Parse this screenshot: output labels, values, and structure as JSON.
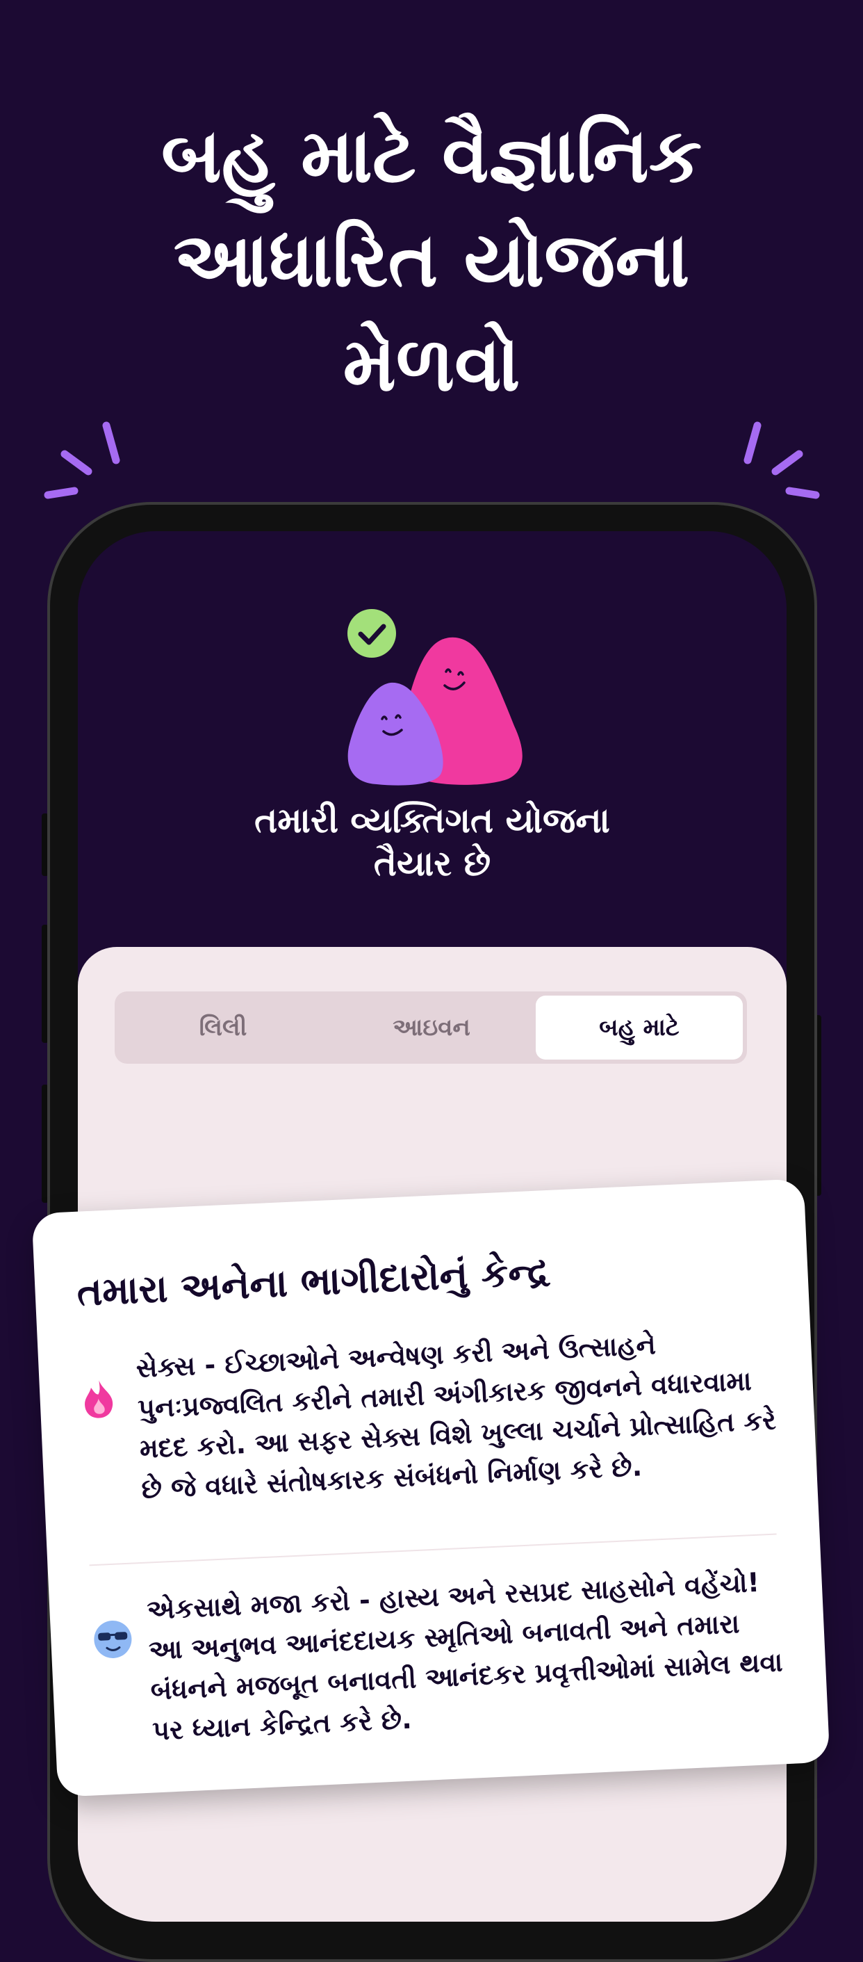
{
  "headline": {
    "line1": "બહુ માટે વૈજ્ઞાનિક",
    "line2": "આધારિત યોજના",
    "line3": "મેળવો"
  },
  "colors": {
    "background": "#1c0a33",
    "accent_purple": "#a66bf2",
    "mascot_pink": "#f0399f",
    "check_green": "#a3e07a",
    "sheet": "#f3e8ec"
  },
  "phone": {
    "ready_title_line1": "તમારી વ્યક્તિગત યોજના",
    "ready_title_line2": "તૈયાર છે",
    "tabs": [
      {
        "label": "લિલી",
        "active": false
      },
      {
        "label": "આઇવન",
        "active": false
      },
      {
        "label": "બહુ માટે",
        "active": true
      }
    ]
  },
  "card": {
    "title": "તમારા અનેના ભાગીદારોનું કેન્દ્ર",
    "items": [
      {
        "icon": "flame-icon",
        "text": "સેક્સ - ઈચ્છાઓને અન્વેષણ કરી અને ઉત્સાહને પુનઃપ્રજ્વલિત કરીને તમારી અંગીકારક જીવનને વધારવામા મદદ કરો. આ સફર સેક્સ વિશે ખુલ્લા ચર્ચાને પ્રોત્સાહિત કરે છે જે વધારે સંતોષકારક સંબંધનો નિર્માણ કરે છે."
      },
      {
        "icon": "sunglasses-face-icon",
        "text": "એકસાથે મજા કરો - હાસ્ય અને રસપ્રદ સાહસોને વહેંચો! આ અનુભવ આનંદદાયક સ્મૃતિઓ બનાવતી અને તમારા બંધનને મજબૂત બનાવતી આનંદકર પ્રવૃત્તીઓમાં સામેલ થવા પર ધ્યાન કેન્દ્રિત કરે છે."
      }
    ]
  }
}
